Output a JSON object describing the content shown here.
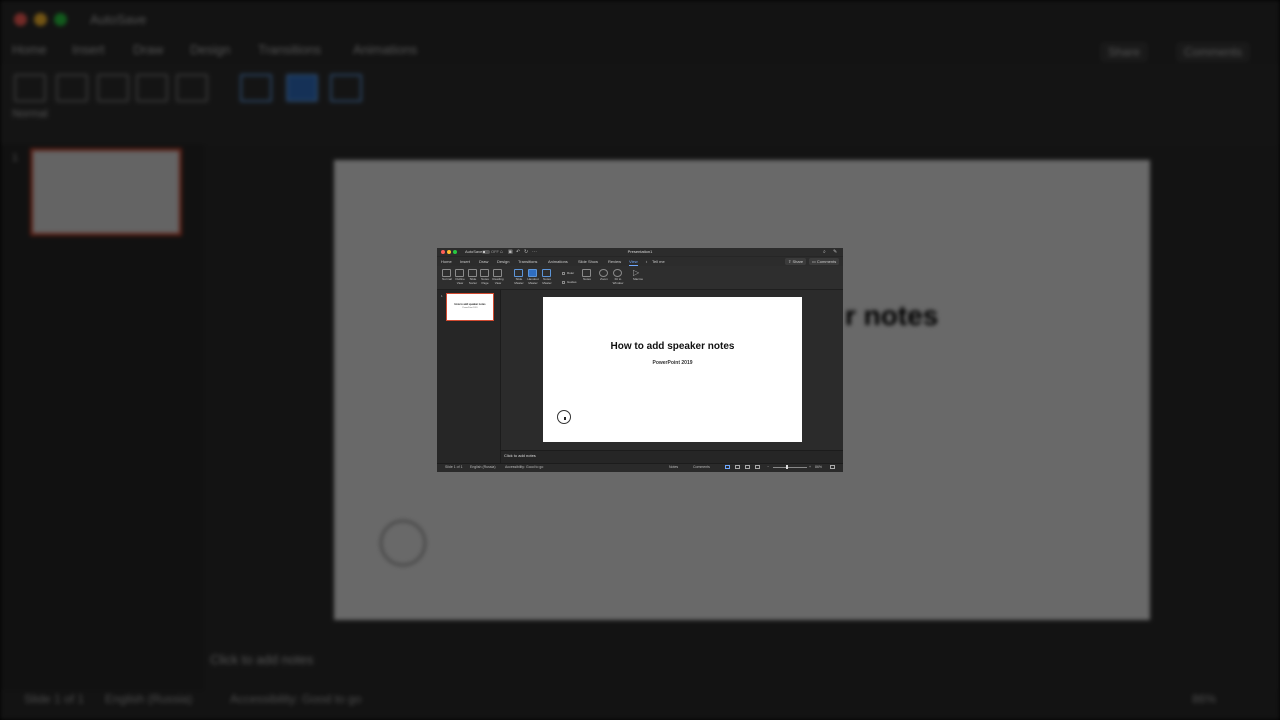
{
  "app": {
    "autosave_label": "AutoSave",
    "autosave_state": "OFF",
    "window_title": "Presentation1"
  },
  "tabs": [
    {
      "label": "Home",
      "active": false
    },
    {
      "label": "Insert",
      "active": false
    },
    {
      "label": "Draw",
      "active": false
    },
    {
      "label": "Design",
      "active": false
    },
    {
      "label": "Transitions",
      "active": false
    },
    {
      "label": "Animations",
      "active": false
    },
    {
      "label": "Slide Show",
      "active": false
    },
    {
      "label": "Review",
      "active": false
    },
    {
      "label": "View",
      "active": true
    },
    {
      "label": "Tell me",
      "active": false
    }
  ],
  "header_buttons": {
    "share": "Share",
    "comments": "Comments"
  },
  "ribbon": {
    "normal": "Normal",
    "outline_view": "Outline\nView",
    "slide_sorter": "Slide\nSorter",
    "notes_page": "Notes\nPage",
    "reading_view": "Reading\nView",
    "slide_master": "Slide\nMaster",
    "handout_master": "Handout\nMaster",
    "notes_master": "Notes\nMaster",
    "ruler": "Ruler",
    "guides": "Guides",
    "notes": "Notes",
    "zoom": "Zoom",
    "fit_to_window": "Fit to\nWindow",
    "macros": "Macros"
  },
  "thumbnail": {
    "number": "1",
    "title": "How to add speaker notes",
    "subtitle": "PowerPoint 2019"
  },
  "slide": {
    "title": "How to add speaker notes",
    "subtitle": "PowerPoint 2019"
  },
  "notes_placeholder": "Click to add notes",
  "status_bar": {
    "slide_count": "Slide 1 of 1",
    "language": "English (Russia)",
    "accessibility": "Accessibility: Good to go",
    "notes": "Notes",
    "comments": "Comments",
    "zoom": "86%"
  },
  "background_copy": {
    "partial_slide_title": "r notes"
  },
  "colors": {
    "accent_blue": "#6fa8ff",
    "thumb_border": "#d24a30",
    "close": "#ff5f57",
    "minimize": "#febc2e",
    "maximize": "#28c840"
  },
  "icons": [
    "home-icon",
    "save-icon",
    "undo-icon",
    "redo-icon",
    "more-icon",
    "search-icon",
    "feedback-icon",
    "lightbulb-icon",
    "share-icon",
    "comment-icon",
    "play-icon",
    "zoom-icon",
    "fit-window-icon"
  ]
}
